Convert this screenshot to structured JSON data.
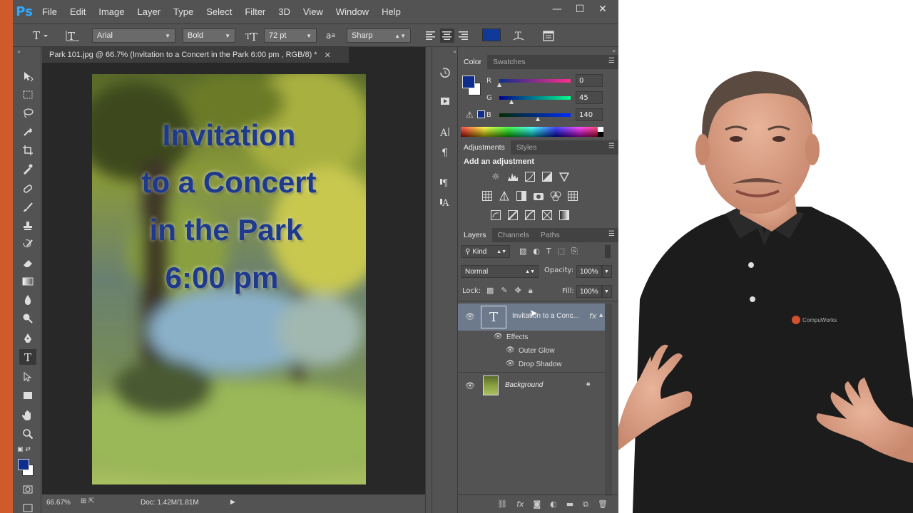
{
  "app": {
    "logo": "Ps"
  },
  "menu": [
    "File",
    "Edit",
    "Image",
    "Layer",
    "Type",
    "Select",
    "Filter",
    "3D",
    "View",
    "Window",
    "Help"
  ],
  "window_controls": {
    "minimize": "—",
    "maximize": "☐",
    "close": "✕"
  },
  "options_bar": {
    "font_family": "Arial",
    "font_style": "Bold",
    "font_size": "72 pt",
    "anti_alias_symbol": "a",
    "anti_alias": "Sharp",
    "text_color": "#0f3a9a"
  },
  "document": {
    "tab_title": "Park 101.jpg @ 66.7% (Invitation to a Concert in the Park 6:00 pm , RGB/8) *",
    "lines": [
      "Invitation",
      "to a Concert",
      "in the Park",
      "6:00 pm"
    ]
  },
  "status": {
    "zoom": "66.67%",
    "doc_info": "Doc: 1.42M/1.81M"
  },
  "color_panel": {
    "tabs": [
      "Color",
      "Swatches"
    ],
    "r_label": "R",
    "g_label": "G",
    "b_label": "B",
    "r": "0",
    "g": "45",
    "b": "140",
    "foreground": "#0f2d8c"
  },
  "adjustments_panel": {
    "tabs": [
      "Adjustments",
      "Styles"
    ],
    "heading": "Add an adjustment"
  },
  "layers_panel": {
    "tabs": [
      "Layers",
      "Channels",
      "Paths"
    ],
    "filter_kind": "Kind",
    "blend_mode": "Normal",
    "opacity_label": "Opacity:",
    "opacity": "100%",
    "lock_label": "Lock:",
    "fill_label": "Fill:",
    "fill": "100%",
    "layers": [
      {
        "name": "Invitation to a Conc...",
        "fx": "fx",
        "thumb": "T"
      },
      {
        "name": "Background"
      }
    ],
    "effects_label": "Effects",
    "effects": [
      "Outer Glow",
      "Drop Shadow"
    ]
  },
  "presenter": {
    "shirt_logo": "CompuWorks"
  }
}
